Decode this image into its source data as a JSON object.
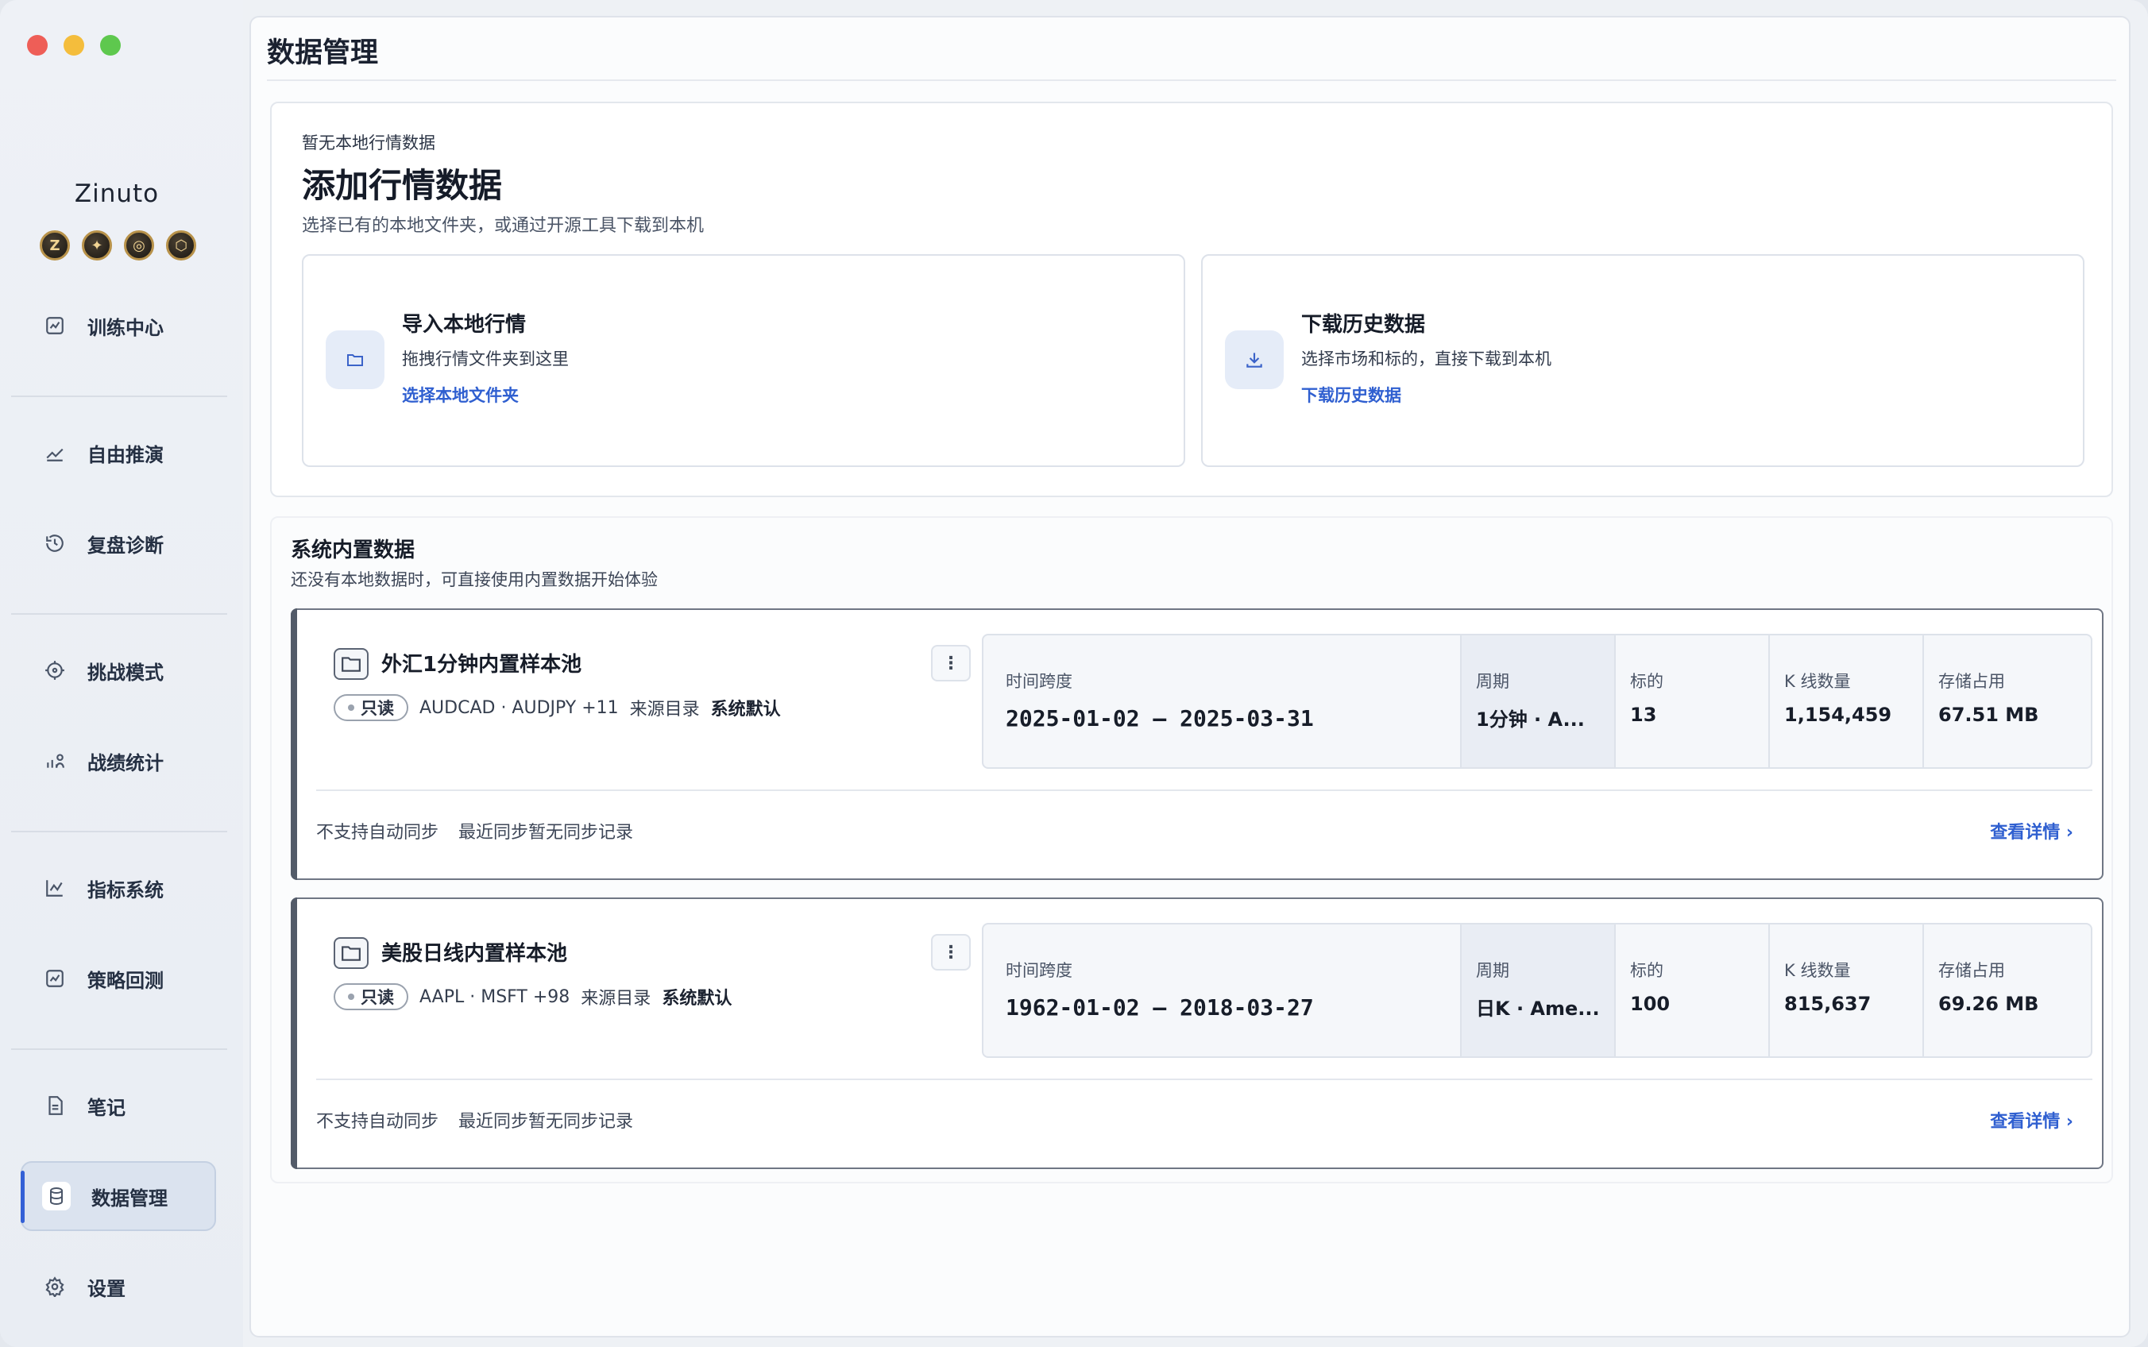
{
  "sidebar": {
    "brand": "Zinuto",
    "badges": [
      "Z",
      "✦",
      "◎",
      "⬡"
    ],
    "items": [
      {
        "label": "训练中心",
        "icon": "chart-image-icon"
      },
      {
        "label": "自由推演",
        "icon": "trend-line-icon"
      },
      {
        "label": "复盘诊断",
        "icon": "history-icon"
      },
      {
        "label": "挑战模式",
        "icon": "target-icon"
      },
      {
        "label": "战绩统计",
        "icon": "stats-user-icon"
      },
      {
        "label": "指标系统",
        "icon": "line-chart-icon"
      },
      {
        "label": "策略回测",
        "icon": "chart-image-icon"
      },
      {
        "label": "笔记",
        "icon": "note-icon"
      },
      {
        "label": "数据管理",
        "icon": "database-icon"
      },
      {
        "label": "设置",
        "icon": "gear-icon"
      }
    ],
    "active_item": "数据管理"
  },
  "main": {
    "title": "数据管理",
    "hero": {
      "eyebrow": "暂无本地行情数据",
      "title": "添加行情数据",
      "description": "选择已有的本地文件夹，或通过开源工具下载到本机",
      "import": {
        "title": "导入本地行情",
        "subtitle": "拖拽行情文件夹到这里",
        "link": "选择本地文件夹"
      },
      "download": {
        "title": "下载历史数据",
        "subtitle": "选择市场和标的，直接下载到本机",
        "link": "下载历史数据"
      }
    },
    "builtin": {
      "title": "系统内置数据",
      "description": "还没有本地数据时，可直接使用内置数据开始体验",
      "pools": [
        {
          "name": "外汇1分钟内置样本池",
          "readonly": "只读",
          "symbols": "AUDCAD · AUDJPY +11",
          "source_label": "来源目录",
          "source_value": "系统默认",
          "span_label": "时间跨度",
          "span_value": "2025-01-02 — 2025-03-31",
          "cycle_label": "周期",
          "cycle_value": "1分钟 · A...",
          "symbols_label": "标的",
          "symbols_value": "13",
          "kline_label": "K 线数量",
          "kline_value": "1,154,459",
          "storage_label": "存储占用",
          "storage_value": "67.51 MB",
          "sync_status": "不支持自动同步",
          "last_sync": "最近同步暂无同步记录",
          "detail_link": "查看详情"
        },
        {
          "name": "美股日线内置样本池",
          "readonly": "只读",
          "symbols": "AAPL · MSFT +98",
          "source_label": "来源目录",
          "source_value": "系统默认",
          "span_label": "时间跨度",
          "span_value": "1962-01-02 — 2018-03-27",
          "cycle_label": "周期",
          "cycle_value": "日K · Ame...",
          "symbols_label": "标的",
          "symbols_value": "100",
          "kline_label": "K 线数量",
          "kline_value": "815,637",
          "storage_label": "存储占用",
          "storage_value": "69.26 MB",
          "sync_status": "不支持自动同步",
          "last_sync": "最近同步暂无同步记录",
          "detail_link": "查看详情"
        }
      ]
    }
  },
  "colors": {
    "accent": "#3360d6",
    "link": "#2f5fd0",
    "traffic_red": "#ee5e57",
    "traffic_yellow": "#f4bd3c",
    "traffic_green": "#5ec84e"
  }
}
